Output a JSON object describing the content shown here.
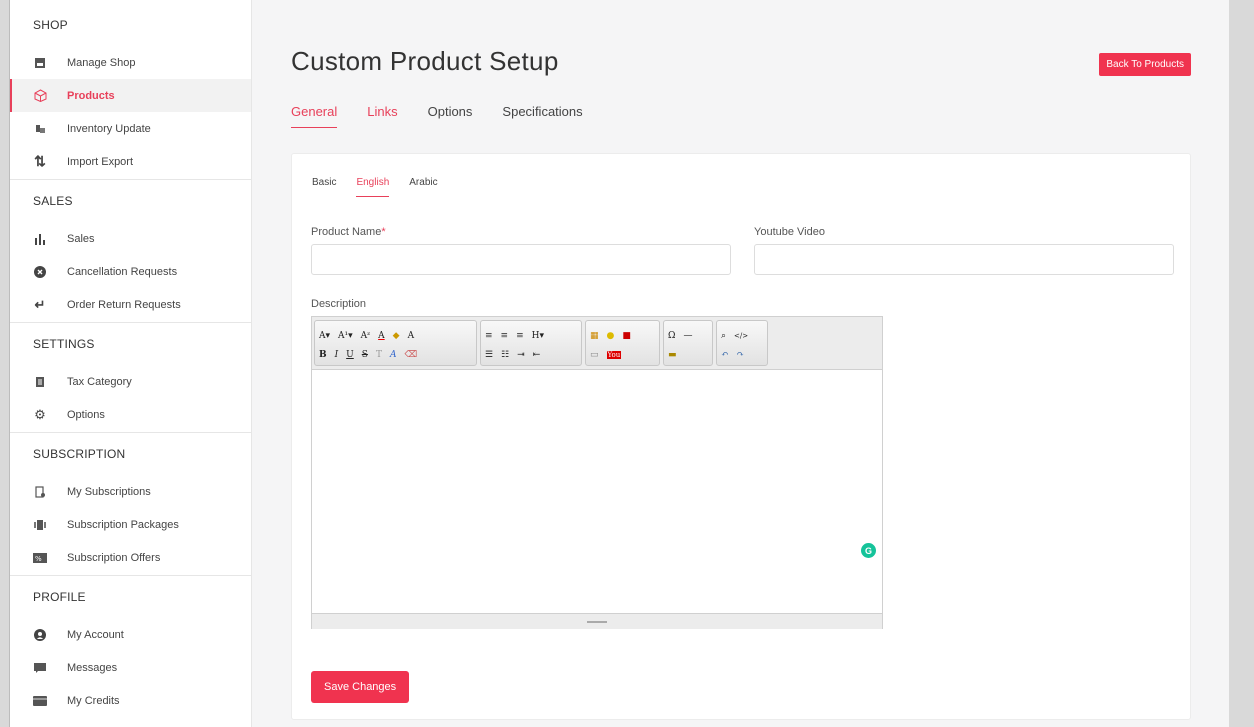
{
  "sidebar": {
    "sections": [
      {
        "title": "SHOP",
        "items": [
          {
            "label": "Manage Shop",
            "icon": "shop-icon"
          },
          {
            "label": "Products",
            "icon": "box-icon",
            "active": true
          },
          {
            "label": "Inventory Update",
            "icon": "inventory-icon"
          },
          {
            "label": "Import Export",
            "icon": "import-export-icon"
          }
        ]
      },
      {
        "title": "SALES",
        "items": [
          {
            "label": "Sales",
            "icon": "bar-chart-icon"
          },
          {
            "label": "Cancellation Requests",
            "icon": "cancel-icon"
          },
          {
            "label": "Order Return Requests",
            "icon": "return-icon"
          }
        ]
      },
      {
        "title": "SETTINGS",
        "items": [
          {
            "label": "Tax Category",
            "icon": "tax-icon"
          },
          {
            "label": "Options",
            "icon": "gear-icon"
          }
        ]
      },
      {
        "title": "SUBSCRIPTION",
        "items": [
          {
            "label": "My Subscriptions",
            "icon": "subscription-icon"
          },
          {
            "label": "Subscription Packages",
            "icon": "packages-icon"
          },
          {
            "label": "Subscription Offers",
            "icon": "offers-icon"
          }
        ]
      },
      {
        "title": "PROFILE",
        "items": [
          {
            "label": "My Account",
            "icon": "account-icon"
          },
          {
            "label": "Messages",
            "icon": "message-icon"
          },
          {
            "label": "My Credits",
            "icon": "credits-icon"
          }
        ]
      }
    ]
  },
  "header": {
    "title": "Custom Product Setup",
    "back_label": "Back To Products"
  },
  "tabs": [
    "General",
    "Links",
    "Options",
    "Specifications"
  ],
  "subtabs": [
    "Basic",
    "English",
    "Arabic"
  ],
  "form": {
    "product_name_label": "Product Name",
    "required_mark": "*",
    "product_name_value": "",
    "youtube_label": "Youtube Video",
    "youtube_value": "",
    "description_label": "Description",
    "save_label": "Save Changes"
  },
  "colors": {
    "accent": "#f0334f",
    "grammarly": "#15c39a"
  }
}
